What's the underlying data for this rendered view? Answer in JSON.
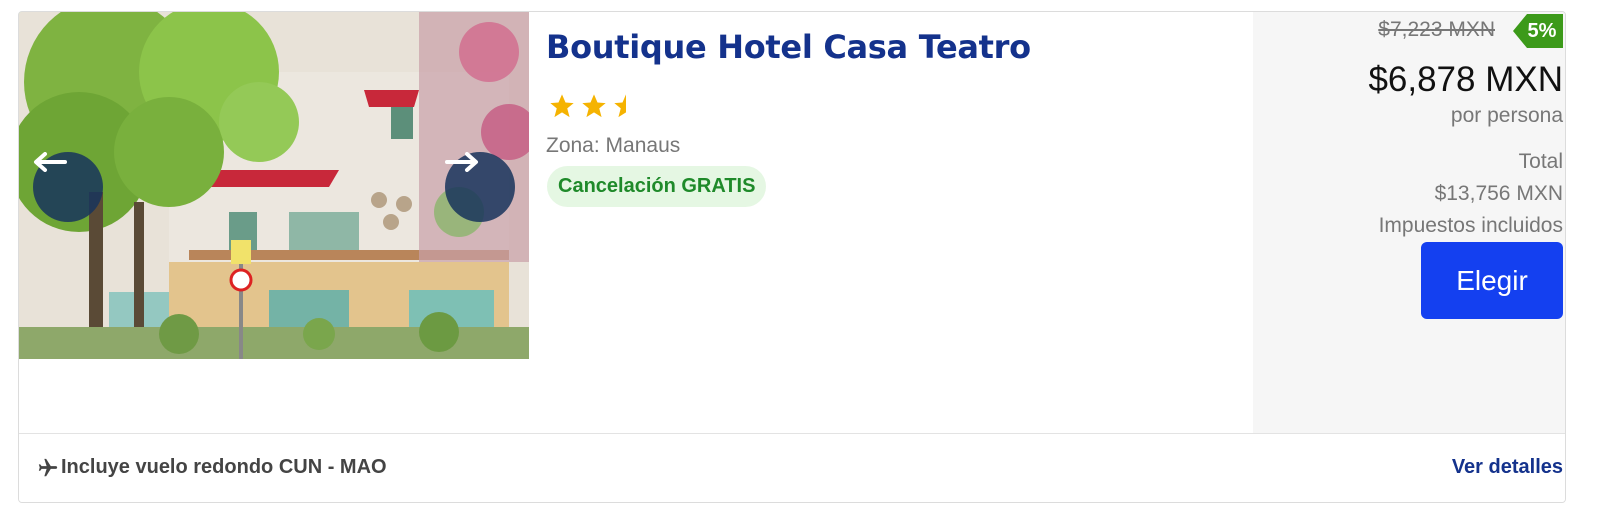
{
  "hotel": {
    "name": "Boutique Hotel Casa Teatro",
    "rating_stars": 2.5,
    "zone": "Zona: Manaus",
    "cancellation_badge": "Cancelación GRATIS"
  },
  "gallery": {
    "prev_icon": "arrow-left-icon",
    "next_icon": "arrow-right-icon"
  },
  "pricing": {
    "old_price": "$7,223 MXN",
    "discount": "5%",
    "price": "$6,878 MXN",
    "per_person": "por persona",
    "total_label": "Total",
    "total_value": "$13,756 MXN",
    "taxes_note": "Impuestos incluidos",
    "choose_label": "Elegir"
  },
  "footer": {
    "flight_icon": "airplane-icon",
    "flight_text": "Incluye vuelo redondo CUN - MAO",
    "details_link": "Ver detalles"
  },
  "colors": {
    "title_blue": "#14328c",
    "button_blue": "#1440f0",
    "discount_green": "#3c9a1a",
    "badge_green_bg": "#e5f7e3",
    "badge_green_text": "#1f8a2a",
    "star_yellow": "#f5b301"
  }
}
